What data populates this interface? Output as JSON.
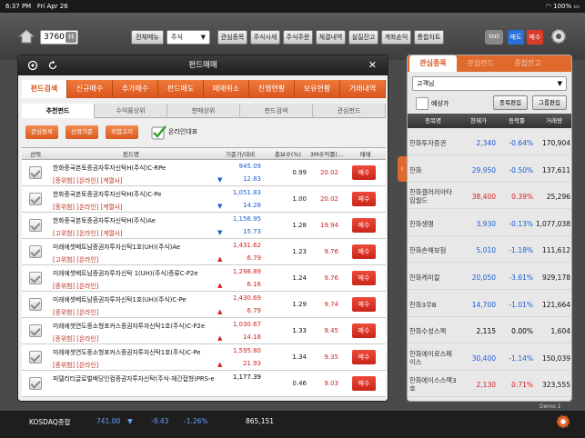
{
  "statusbar": {
    "time": "6:37 PM",
    "date": "Fri Apr 26",
    "battery": "100%"
  },
  "topbar": {
    "code": "3760",
    "code_suffix": "H",
    "all_menu": "전체메뉴",
    "market_select": "주식",
    "buttons": [
      "관심종목",
      "주식시세",
      "주식주문",
      "체결내역",
      "실질잔고",
      "계좌손익",
      "통합차트"
    ],
    "sns": "SNS",
    "sell": "매도",
    "buy": "매수"
  },
  "panel": {
    "title": "펀드매매",
    "main_tabs": [
      "펀드검색",
      "신규매수",
      "추가매수",
      "펀드매도",
      "매매취소",
      "진행현황",
      "보유현황",
      "거래내역"
    ],
    "sub_tabs": [
      "추천펀드",
      "수익률상위",
      "판매상위",
      "펀드검색",
      "관심펀드"
    ],
    "filter_buttons": [
      "관심등록",
      "선정기준",
      "위험고지"
    ],
    "online_label": "온라인대표",
    "headers": [
      "선택",
      "펀드명",
      "기준가/대비",
      "총보수(%)",
      "3M수익률(...",
      "매매"
    ],
    "buy_label": "매수",
    "rows": [
      {
        "name": "한화중국본토증권자투자신탁H(주식)C-RPe",
        "risk": "[중위험] [온라인] [계열사]",
        "price": "945.09",
        "diff": "12.83",
        "dir": "down",
        "fee": "0.99",
        "ret": "20.02",
        "ret_dir": "up"
      },
      {
        "name": "한화중국본토증권자투자신탁H(주식)C-Pe",
        "risk": "[중위험] [온라인] [계열사]",
        "price": "1,051.83",
        "diff": "14.28",
        "dir": "down",
        "fee": "1.00",
        "ret": "20.02",
        "ret_dir": "up"
      },
      {
        "name": "한화중국본토증권자투자신탁H(주식)Ae",
        "risk": "[고위험] [온라인] [계열사]",
        "price": "1,156.95",
        "diff": "15.73",
        "dir": "down",
        "fee": "1.28",
        "ret": "19.94",
        "ret_dir": "up"
      },
      {
        "name": "미래에셋베트남증권자투자신탁1호(UH)(주식)Ae",
        "risk": "[고위험] [온라인]",
        "price": "1,431.62",
        "diff": "6.79",
        "dir": "up",
        "fee": "1.23",
        "ret": "9.76",
        "ret_dir": "up"
      },
      {
        "name": "미래에셋베트남증권자투자신탁 1(UH)(주식)종류C-P2e",
        "risk": "[중위험] [온라인]",
        "price": "1,298.89",
        "diff": "6.16",
        "dir": "up",
        "fee": "1.24",
        "ret": "9.76",
        "ret_dir": "up"
      },
      {
        "name": "미래에셋베트남증권자투자신탁1호(UH)(주식)C-Pe",
        "risk": "[중위험] [온라인]",
        "price": "1,430.69",
        "diff": "6.79",
        "dir": "up",
        "fee": "1.29",
        "ret": "9.74",
        "ret_dir": "up"
      },
      {
        "name": "미래에셋연도중소형포커스증권자투자신탁1호(주식)C-P2e",
        "risk": "[중위험] [온라인]",
        "price": "1,030.67",
        "diff": "14.16",
        "dir": "up",
        "fee": "1.33",
        "ret": "9.45",
        "ret_dir": "up"
      },
      {
        "name": "미래에셋연도중소형포커스증권자투자신탁1호(주식)C-Pe",
        "risk": "[중위험] [온라인]",
        "price": "1,595.80",
        "diff": "21.93",
        "dir": "up",
        "fee": "1.34",
        "ret": "9.35",
        "ret_dir": "up"
      },
      {
        "name": "피델리티글로벌배당인컴증권자투자신탁(주식-재간접형)PRS-e",
        "risk": "",
        "price": "1,177.39",
        "diff": "",
        "dir": "",
        "fee": "0.46",
        "ret": "9.03",
        "ret_dir": "up"
      }
    ]
  },
  "watch": {
    "tabs": [
      "관심종목",
      "관심펀드",
      "종합잔고"
    ],
    "group": "고객님",
    "expected_label": "예상가",
    "edit_stock": "종목편집",
    "edit_group": "그룹편집",
    "headers": [
      "종목명",
      "현재가",
      "등락률",
      "거래량"
    ],
    "rows": [
      {
        "name": "한화투자증권",
        "price": "2,340",
        "change": "-0.64%",
        "volume": "170,904",
        "dir": "down"
      },
      {
        "name": "한화",
        "price": "29,950",
        "change": "-0.50%",
        "volume": "137,611",
        "dir": "down"
      },
      {
        "name": "한화갤러리아타임월드",
        "price": "38,400",
        "change": "0.39%",
        "volume": "25,296",
        "dir": "up"
      },
      {
        "name": "한화생명",
        "price": "3,930",
        "change": "-0.13%",
        "volume": "1,077,038",
        "dir": "down"
      },
      {
        "name": "한화손해보험",
        "price": "5,010",
        "change": "-1.18%",
        "volume": "111,612",
        "dir": "down"
      },
      {
        "name": "한화케미칼",
        "price": "20,050",
        "change": "-3.61%",
        "volume": "929,178",
        "dir": "down"
      },
      {
        "name": "한화3우B",
        "price": "14,700",
        "change": "-1.01%",
        "volume": "121,664",
        "dir": "down"
      },
      {
        "name": "한화수성스팩",
        "price": "2,115",
        "change": "0.00%",
        "volume": "1,604",
        "dir": "flat"
      },
      {
        "name": "한화에이로스페이스",
        "price": "30,400",
        "change": "-1.14%",
        "volume": "150,039",
        "dir": "down"
      },
      {
        "name": "한화에이스스팩3호",
        "price": "2,130",
        "change": "0.71%",
        "volume": "323,555",
        "dir": "up"
      }
    ]
  },
  "ticker": {
    "name": "KOSDAQ종합",
    "value": "741.00",
    "diff": "-9.43",
    "rate": "-1.26%",
    "volume": "865,151"
  },
  "mini_label": "Demo 1"
}
